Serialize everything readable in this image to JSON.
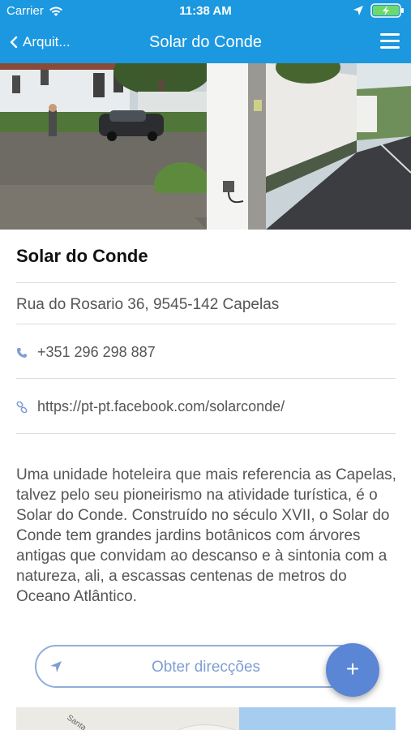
{
  "status_bar": {
    "carrier": "Carrier",
    "time": "11:38 AM",
    "icons": [
      "wifi-icon",
      "location-arrow-icon",
      "battery-charging-icon"
    ]
  },
  "nav": {
    "back_label": "Arquit...",
    "title": "Solar do Conde",
    "menu_icon": "hamburger-menu-icon"
  },
  "place": {
    "name": "Solar do Conde",
    "address": "Rua do Rosario 36, 9545-142 Capelas",
    "phone": "+351 296 298 887",
    "website": "https://pt-pt.facebook.com/solarconde/",
    "description": "Uma unidade hoteleira que mais referencia as Capelas, talvez pelo seu pioneirismo na atividade turística, é o Solar do Conde. Construído no século XVII, o Solar do Conde tem grandes jardins botânicos com árvores antigas que convidam ao descanso e à sintonia com a natureza, ali, a escassas centenas de metros do Oceano Atlântico."
  },
  "directions": {
    "label": "Obter direcções"
  },
  "fab": {
    "label": "+"
  },
  "map": {
    "street_label": "Santa"
  },
  "colors": {
    "header": "#1b98e0",
    "accent": "#5b86d6",
    "button_border": "#8faedb",
    "icon": "#7f9ed3"
  }
}
